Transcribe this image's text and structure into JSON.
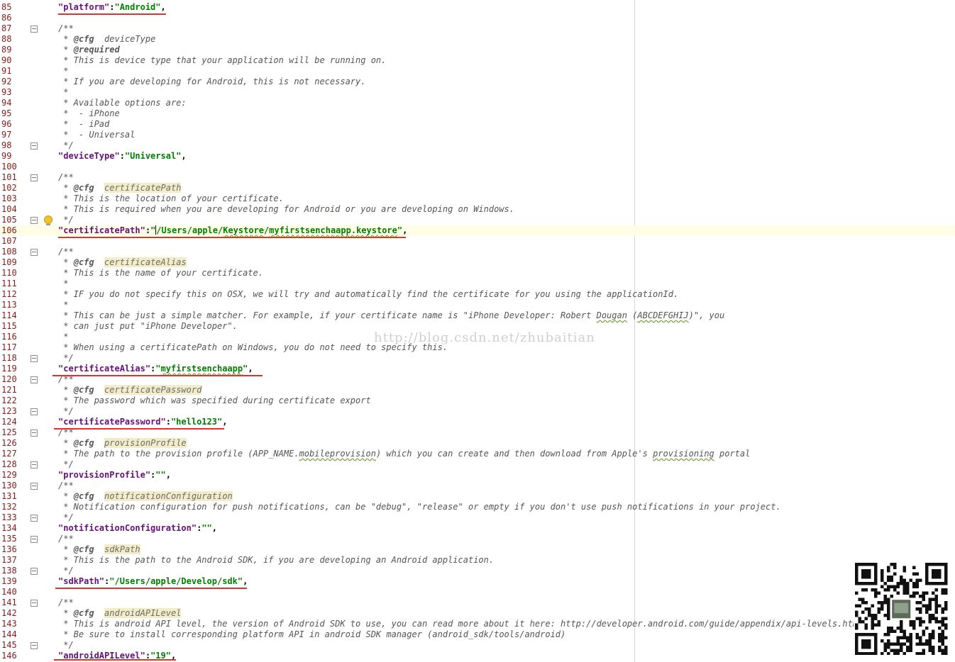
{
  "editor": {
    "watermark": "http://blog.csdn.net/zhubaitian",
    "current_line": 106,
    "qr_icon": "qr-code-icon"
  },
  "lines": [
    {
      "n": "85",
      "c": [
        {
          "t": "\"platform\"",
          "k": "key"
        },
        {
          "t": ":",
          "k": "punct"
        },
        {
          "t": "\"Android\"",
          "k": "str"
        },
        {
          "t": ",",
          "k": "punct"
        }
      ]
    },
    {
      "n": "86",
      "c": []
    },
    {
      "n": "87",
      "fold": true,
      "c": [
        {
          "t": "/**",
          "k": "comment"
        }
      ]
    },
    {
      "n": "88",
      "c": [
        {
          "t": " * ",
          "k": "comment"
        },
        {
          "t": "@cfg",
          "k": "tag"
        },
        {
          "t": "  deviceType",
          "k": "comment"
        }
      ]
    },
    {
      "n": "89",
      "c": [
        {
          "t": " * ",
          "k": "comment"
        },
        {
          "t": "@required",
          "k": "tag"
        }
      ]
    },
    {
      "n": "90",
      "c": [
        {
          "t": " * This is device type that your application will be running on.",
          "k": "comment"
        }
      ]
    },
    {
      "n": "91",
      "c": [
        {
          "t": " *",
          "k": "comment"
        }
      ]
    },
    {
      "n": "92",
      "c": [
        {
          "t": " * If you are developing for Android, this is not necessary.",
          "k": "comment"
        }
      ]
    },
    {
      "n": "93",
      "c": [
        {
          "t": " *",
          "k": "comment"
        }
      ]
    },
    {
      "n": "94",
      "c": [
        {
          "t": " * Available options are:",
          "k": "comment"
        }
      ]
    },
    {
      "n": "95",
      "c": [
        {
          "t": " *  - iPhone",
          "k": "comment"
        }
      ]
    },
    {
      "n": "96",
      "c": [
        {
          "t": " *  - iPad",
          "k": "comment"
        }
      ]
    },
    {
      "n": "97",
      "c": [
        {
          "t": " *  - Universal",
          "k": "comment"
        }
      ]
    },
    {
      "n": "98",
      "fold": true,
      "c": [
        {
          "t": " */",
          "k": "comment"
        }
      ]
    },
    {
      "n": "99",
      "c": [
        {
          "t": "\"deviceType\"",
          "k": "key"
        },
        {
          "t": ":",
          "k": "punct"
        },
        {
          "t": "\"Universal\"",
          "k": "str"
        },
        {
          "t": ",",
          "k": "punct"
        }
      ]
    },
    {
      "n": "100",
      "c": []
    },
    {
      "n": "101",
      "fold": true,
      "c": [
        {
          "t": "/**",
          "k": "comment"
        }
      ]
    },
    {
      "n": "102",
      "c": [
        {
          "t": " * ",
          "k": "comment"
        },
        {
          "t": "@cfg",
          "k": "tag"
        },
        {
          "t": "  ",
          "k": "comment"
        },
        {
          "t": "certificatePath",
          "k": "param"
        }
      ]
    },
    {
      "n": "103",
      "c": [
        {
          "t": " * This is the location of your certificate.",
          "k": "comment"
        }
      ]
    },
    {
      "n": "104",
      "c": [
        {
          "t": " * This is required when you are developing for Android or you are developing on Windows.",
          "k": "comment"
        }
      ]
    },
    {
      "n": "105",
      "fold": true,
      "bulb": true,
      "c": [
        {
          "t": " */",
          "k": "comment"
        }
      ]
    },
    {
      "n": "106",
      "c": [
        {
          "t": "\"certificatePath\"",
          "k": "key"
        },
        {
          "t": ":",
          "k": "punct"
        },
        {
          "t": "\"",
          "k": "str"
        },
        {
          "t": "",
          "k": "cursor"
        },
        {
          "t": "/Users/apple/",
          "k": "str"
        },
        {
          "t": "Keystore",
          "k": "str spell"
        },
        {
          "t": "/",
          "k": "str"
        },
        {
          "t": "myfirstsenchaapp.keystore",
          "k": "str spell"
        },
        {
          "t": "\"",
          "k": "str"
        },
        {
          "t": ",",
          "k": "punct"
        }
      ]
    },
    {
      "n": "107",
      "c": []
    },
    {
      "n": "108",
      "fold": true,
      "c": [
        {
          "t": "/**",
          "k": "comment"
        }
      ]
    },
    {
      "n": "109",
      "c": [
        {
          "t": " * ",
          "k": "comment"
        },
        {
          "t": "@cfg",
          "k": "tag"
        },
        {
          "t": "  ",
          "k": "comment"
        },
        {
          "t": "certificateAlias",
          "k": "param"
        }
      ]
    },
    {
      "n": "110",
      "c": [
        {
          "t": " * This is the name of your certificate.",
          "k": "comment"
        }
      ]
    },
    {
      "n": "111",
      "c": [
        {
          "t": " *",
          "k": "comment"
        }
      ]
    },
    {
      "n": "112",
      "c": [
        {
          "t": " * IF you do not specify this on OSX, we will try and automatically find the certificate for you using the applicationId.",
          "k": "comment"
        }
      ]
    },
    {
      "n": "113",
      "c": [
        {
          "t": " *",
          "k": "comment"
        }
      ]
    },
    {
      "n": "114",
      "c": [
        {
          "t": " * This can be just a simple matcher. For example, if your certificate name is \"iPhone Developer: Robert ",
          "k": "comment"
        },
        {
          "t": "Dougan",
          "k": "comment spell"
        },
        {
          "t": " (",
          "k": "comment"
        },
        {
          "t": "ABCDEFGHIJ",
          "k": "comment spell"
        },
        {
          "t": ")\", you",
          "k": "comment"
        }
      ]
    },
    {
      "n": "115",
      "c": [
        {
          "t": " * can just put \"iPhone Developer\".",
          "k": "comment"
        }
      ]
    },
    {
      "n": "116",
      "c": [
        {
          "t": " *",
          "k": "comment"
        }
      ]
    },
    {
      "n": "117",
      "c": [
        {
          "t": " * When using a certificatePath on Windows, you do not need to specify this.",
          "k": "comment"
        }
      ]
    },
    {
      "n": "118",
      "fold": true,
      "c": [
        {
          "t": " */",
          "k": "comment"
        }
      ]
    },
    {
      "n": "119",
      "c": [
        {
          "t": "\"certificateAlias\"",
          "k": "key"
        },
        {
          "t": ":",
          "k": "punct"
        },
        {
          "t": "\"",
          "k": "str"
        },
        {
          "t": "myfirstsenchaapp",
          "k": "str spell"
        },
        {
          "t": "\"",
          "k": "str"
        },
        {
          "t": ",",
          "k": "punct"
        }
      ]
    },
    {
      "n": "120",
      "fold": true,
      "c": [
        {
          "t": "/**",
          "k": "comment"
        }
      ]
    },
    {
      "n": "121",
      "c": [
        {
          "t": " * ",
          "k": "comment"
        },
        {
          "t": "@cfg",
          "k": "tag"
        },
        {
          "t": "  ",
          "k": "comment"
        },
        {
          "t": "certificatePassword",
          "k": "param"
        }
      ]
    },
    {
      "n": "122",
      "c": [
        {
          "t": " * The password which was specified during certificate export",
          "k": "comment"
        }
      ]
    },
    {
      "n": "123",
      "fold": true,
      "c": [
        {
          "t": " */",
          "k": "comment"
        }
      ]
    },
    {
      "n": "124",
      "c": [
        {
          "t": "\"certificatePassword\"",
          "k": "key"
        },
        {
          "t": ":",
          "k": "punct"
        },
        {
          "t": "\"hello123\"",
          "k": "str"
        },
        {
          "t": ",",
          "k": "punct"
        }
      ]
    },
    {
      "n": "125",
      "fold": true,
      "c": [
        {
          "t": "/**",
          "k": "comment"
        }
      ]
    },
    {
      "n": "126",
      "c": [
        {
          "t": " * ",
          "k": "comment"
        },
        {
          "t": "@cfg",
          "k": "tag"
        },
        {
          "t": "  ",
          "k": "comment"
        },
        {
          "t": "provisionProfile",
          "k": "param"
        }
      ]
    },
    {
      "n": "127",
      "c": [
        {
          "t": " * The path to the provision profile (APP_NAME.",
          "k": "comment"
        },
        {
          "t": "mobileprovision",
          "k": "comment spell"
        },
        {
          "t": ") which you can create and then download from Apple's ",
          "k": "comment"
        },
        {
          "t": "provisioning",
          "k": "comment spell"
        },
        {
          "t": " portal",
          "k": "comment"
        }
      ]
    },
    {
      "n": "128",
      "fold": true,
      "c": [
        {
          "t": " */",
          "k": "comment"
        }
      ]
    },
    {
      "n": "129",
      "c": [
        {
          "t": "\"provisionProfile\"",
          "k": "key"
        },
        {
          "t": ":",
          "k": "punct"
        },
        {
          "t": "\"\"",
          "k": "str"
        },
        {
          "t": ",",
          "k": "punct"
        }
      ]
    },
    {
      "n": "130",
      "fold": true,
      "c": [
        {
          "t": "/**",
          "k": "comment"
        }
      ]
    },
    {
      "n": "131",
      "c": [
        {
          "t": " * ",
          "k": "comment"
        },
        {
          "t": "@cfg",
          "k": "tag"
        },
        {
          "t": "  ",
          "k": "comment"
        },
        {
          "t": "notificationConfiguration",
          "k": "param"
        }
      ]
    },
    {
      "n": "132",
      "c": [
        {
          "t": " * Notification configuration for push notifications, can be \"debug\", \"release\" or empty if you don't use push notifications in your project.",
          "k": "comment"
        }
      ]
    },
    {
      "n": "133",
      "fold": true,
      "c": [
        {
          "t": " */",
          "k": "comment"
        }
      ]
    },
    {
      "n": "134",
      "c": [
        {
          "t": "\"notificationConfiguration\"",
          "k": "key"
        },
        {
          "t": ":",
          "k": "punct"
        },
        {
          "t": "\"\"",
          "k": "str"
        },
        {
          "t": ",",
          "k": "punct"
        }
      ]
    },
    {
      "n": "135",
      "fold": true,
      "c": [
        {
          "t": "/**",
          "k": "comment"
        }
      ]
    },
    {
      "n": "136",
      "c": [
        {
          "t": " * ",
          "k": "comment"
        },
        {
          "t": "@cfg",
          "k": "tag"
        },
        {
          "t": "  ",
          "k": "comment"
        },
        {
          "t": "sdkPath",
          "k": "param"
        }
      ]
    },
    {
      "n": "137",
      "c": [
        {
          "t": " * This is the path to the Android SDK, if you are developing an Android application.",
          "k": "comment"
        }
      ]
    },
    {
      "n": "138",
      "fold": true,
      "c": [
        {
          "t": " */",
          "k": "comment"
        }
      ]
    },
    {
      "n": "139",
      "c": [
        {
          "t": "\"sdkPath\"",
          "k": "key"
        },
        {
          "t": ":",
          "k": "punct"
        },
        {
          "t": "\"/Users/apple/Develop/sdk\"",
          "k": "str"
        },
        {
          "t": ",",
          "k": "punct"
        }
      ]
    },
    {
      "n": "140",
      "c": []
    },
    {
      "n": "141",
      "fold": true,
      "c": [
        {
          "t": "/**",
          "k": "comment"
        }
      ]
    },
    {
      "n": "142",
      "c": [
        {
          "t": " * ",
          "k": "comment"
        },
        {
          "t": "@cfg",
          "k": "tag"
        },
        {
          "t": "  ",
          "k": "comment"
        },
        {
          "t": "androidAPILevel",
          "k": "param"
        }
      ]
    },
    {
      "n": "143",
      "c": [
        {
          "t": " * This is android API level, the version of Android SDK to use, you can read more about it here: http://developer.android.com/guide/appendix/api-levels.html.",
          "k": "comment"
        }
      ]
    },
    {
      "n": "144",
      "c": [
        {
          "t": " * Be sure to install corresponding platform API in android SDK manager (android_sdk/tools/android)",
          "k": "comment"
        }
      ]
    },
    {
      "n": "145",
      "fold": true,
      "c": [
        {
          "t": " */",
          "k": "comment"
        }
      ]
    },
    {
      "n": "146",
      "c": [
        {
          "t": "\"androidAPILevel\"",
          "k": "key"
        },
        {
          "t": ":",
          "k": "punct"
        },
        {
          "t": "\"19\"",
          "k": "str"
        },
        {
          "t": ",",
          "k": "punct"
        }
      ]
    }
  ]
}
